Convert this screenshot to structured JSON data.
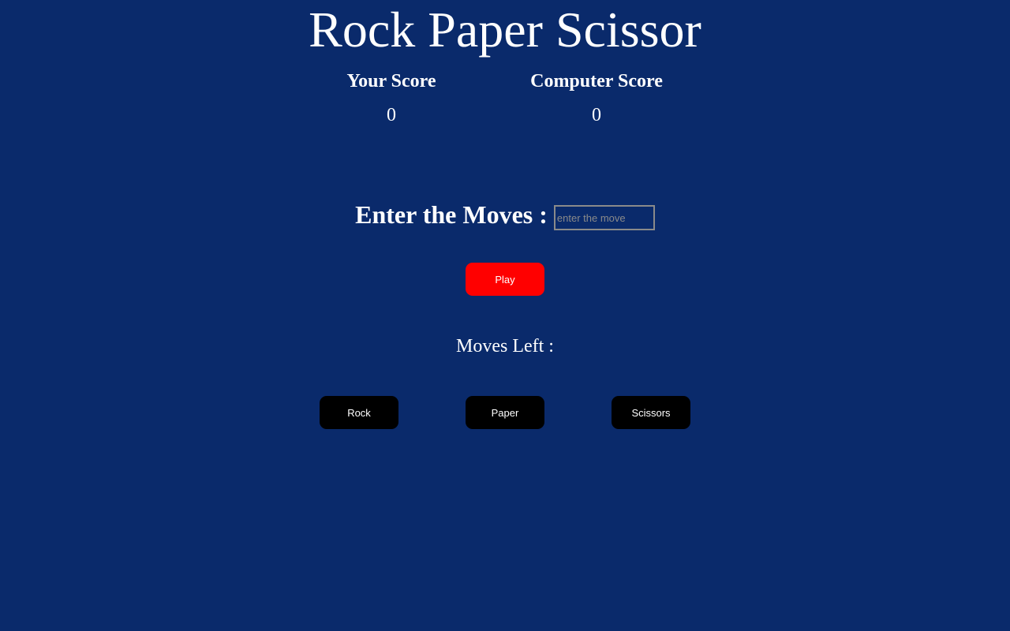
{
  "app": {
    "title": "Rock Paper Scissor"
  },
  "scores": {
    "player": {
      "label": "Your Score",
      "value": "0"
    },
    "computer": {
      "label": "Computer Score",
      "value": "0"
    }
  },
  "moves_entry": {
    "label": "Enter the Moves :",
    "value": "",
    "placeholder": "enter the move"
  },
  "play_button": {
    "label": "Play",
    "color": "#ff0000"
  },
  "moves_left": {
    "label": "Moves Left :"
  },
  "choices": {
    "rock": "Rock",
    "paper": "Paper",
    "scissors": "Scissors"
  },
  "colors": {
    "background": "#0a2a6b",
    "choice_button": "#000000",
    "text": "#ffffff"
  }
}
